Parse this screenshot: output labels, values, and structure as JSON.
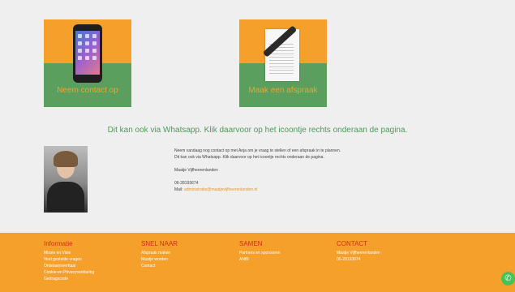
{
  "tiles": [
    {
      "label": "Neem contact op"
    },
    {
      "label": "Maak een afspraak"
    }
  ],
  "whatsapp_note": "Dit kan ook via Whatsapp. Klik daarvoor op het icoontje rechts onderaan de pagina.",
  "info": {
    "line1": "Neem vandaag nog contact op met Anja om je vraag te stellen of een afspraak in te plannen.",
    "line2": "Dit kan ook via Whatsapp. Klik daarvoor op het icoontje rechts onderaan de pagina.",
    "name": "Maatje Vijfheerenlanden",
    "phone": "06-28193674",
    "mail_label": "Mail:",
    "mail": "administratie@maatjevijfheerenlanden.nl"
  },
  "footer": {
    "col1": {
      "title": "Informatie",
      "items": [
        "Missie en Visie",
        "Veel gestelde vragen",
        "Ontstaansverhaal",
        "Cookie-en Privacyverklaring",
        "Gedragscode"
      ]
    },
    "col2": {
      "title": "SNEL NAAR",
      "items": [
        "Afspraak maken",
        "Maatje worden",
        "Contact"
      ]
    },
    "col3": {
      "title": "SAMEN",
      "items": [
        "Partners en sponsoren",
        "ANBI"
      ]
    },
    "col4": {
      "title": "CONTACT",
      "items": [
        "Maatje Vijfheerenlanden",
        "06-28193674"
      ]
    }
  },
  "colors": {
    "orange": "#f5a02a",
    "green": "#5a9f5e",
    "footer_title": "#d9291b"
  },
  "icons": {
    "whatsapp": "whatsapp-icon"
  }
}
